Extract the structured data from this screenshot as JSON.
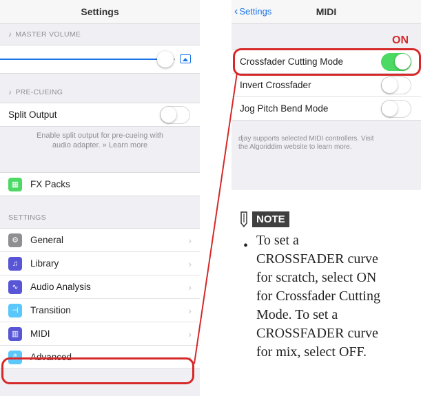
{
  "left": {
    "title": "Settings",
    "master_volume_header": "MASTER VOLUME",
    "pre_cueing_header": "PRE-CUEING",
    "split_output_label": "Split Output",
    "split_output_note_1": "Enable split output for pre-cueing with",
    "split_output_note_2": "audio adapter. » Learn more",
    "fx_packs_label": "FX Packs",
    "settings_header": "SETTINGS",
    "items": [
      {
        "label": "General",
        "icon": "gear-icon",
        "color": "#8e8e93"
      },
      {
        "label": "Library",
        "icon": "music-note-icon",
        "color": "#5856d6"
      },
      {
        "label": "Audio Analysis",
        "icon": "waveform-icon",
        "color": "#5856d6"
      },
      {
        "label": "Transition",
        "icon": "transition-icon",
        "color": "#5ac8fa"
      },
      {
        "label": "MIDI",
        "icon": "midi-keyboard-icon",
        "color": "#5856d6"
      },
      {
        "label": "Advanced",
        "icon": "advanced-icon",
        "color": "#5ac8fa"
      }
    ]
  },
  "right": {
    "back_label": "Settings",
    "title": "MIDI",
    "on_label": "ON",
    "items": [
      {
        "label": "Crossfader Cutting Mode",
        "on": true
      },
      {
        "label": "Invert Crossfader",
        "on": false
      },
      {
        "label": "Jog Pitch Bend Mode",
        "on": false
      }
    ],
    "note_1": "djay supports selected MIDI controllers. Visit",
    "note_2": "the Algoriddim website to learn more."
  },
  "note": {
    "badge": "NOTE",
    "bullet": "•",
    "lines": [
      "To set a",
      "CROSSFADER curve",
      "for scratch, select ON",
      "for Crossfader Cutting",
      "Mode. To set a",
      "CROSSFADER curve",
      "for mix, select OFF."
    ]
  },
  "colors": {
    "highlight": "#d62828",
    "toggle_on": "#4cd964",
    "ios_blue": "#1a73e8"
  }
}
